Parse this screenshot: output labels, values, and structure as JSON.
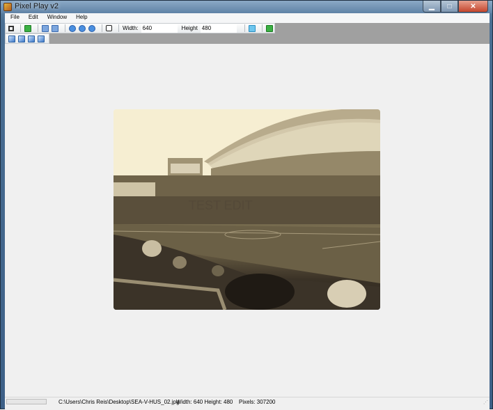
{
  "window": {
    "title": "Pixel Play v2"
  },
  "menu": [
    "File",
    "Edit",
    "Window",
    "Help"
  ],
  "toolbar": {
    "icons_row1": [
      "crop-icon",
      "save-green-icon",
      "flip-vertical-icon",
      "flip-horizontal-icon",
      "rotate-left-icon",
      "rotate-right-icon",
      "rotate-icon",
      "border-icon"
    ],
    "width_label": "Width:",
    "width_value": "640",
    "height_label": "Height",
    "height_value": "480",
    "icons_row2": [
      "image-effect-icon-1",
      "image-effect-icon-2",
      "image-effect-icon-3",
      "image-effect-icon-4"
    ]
  },
  "image": {
    "watermark_text": "TEST EDIT"
  },
  "status": {
    "progress": 0,
    "file_path": "C:\\Users\\Chris Reis\\Desktop\\SEA-V-HUS_02.jpg",
    "dimensions": "Width: 640 Height: 480",
    "pixels": "Pixels: 307200"
  }
}
